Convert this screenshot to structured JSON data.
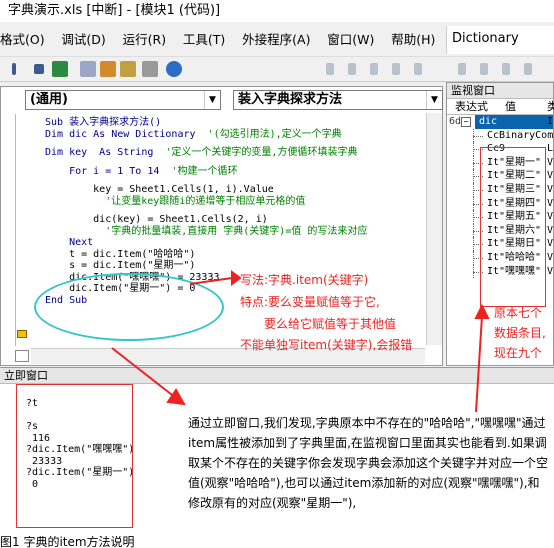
{
  "window": {
    "title": "字典演示.xls [中断] - [模块1 (代码)]"
  },
  "menu": {
    "items": [
      "格式(O)",
      "调试(D)",
      "运行(R)",
      "工具(T)",
      "外接程序(A)",
      "窗口(W)",
      "帮助(H)"
    ],
    "dictionary_box": "Dictionary"
  },
  "code_window": {
    "object_combo": "(通用)",
    "proc_combo": "装入字典探求方法",
    "lines": [
      {
        "code": "Sub 装入字典探求方法()",
        "comment": ""
      },
      {
        "code": "Dim dic As New Dictionary",
        "comment": "'(勾选引用法),定义一个字典"
      },
      {
        "code": "",
        "comment": ""
      },
      {
        "code": "Dim key  As String",
        "comment": "'定义一个关键字的变量,方便循环填装字典"
      },
      {
        "code": "",
        "comment": ""
      },
      {
        "code": "    For i = 1 To 14",
        "comment": "'构建一个循环"
      },
      {
        "code": "",
        "comment": ""
      },
      {
        "code": "        key = Sheet1.Cells(1, i).Value",
        "comment": ""
      },
      {
        "code": "        ",
        "comment": "'让变量key跟随i的递增等于相应单元格的值"
      },
      {
        "code": "",
        "comment": ""
      },
      {
        "code": "        dic(key) = Sheet1.Cells(2, i)",
        "comment": ""
      },
      {
        "code": "        ",
        "comment": "'字典的批量填装,直接用 字典(关键字)=值 的写法来对应"
      },
      {
        "code": "    Next",
        "comment": ""
      },
      {
        "code": "    t = dic.Item(\"哈哈哈\")",
        "comment": ""
      },
      {
        "code": "    s = dic.Item(\"星期一\")",
        "comment": ""
      },
      {
        "code": "    dic.Item(\"嘿嘿嘿\") = 23333",
        "comment": ""
      },
      {
        "code": "    dic.Item(\"星期一\") = 0",
        "comment": ""
      },
      {
        "code": "End Sub",
        "comment": ""
      }
    ]
  },
  "watch_window": {
    "title": "监视窗口",
    "col_expr": "表达式",
    "col_value": "值",
    "col_type": "类",
    "root": "dic",
    "items": [
      {
        "expr": "CcBinaryCompare",
        "value": ""
      },
      {
        "expr": "Cc9",
        "value": "L"
      },
      {
        "expr": "It\"星期一\"",
        "value": "V"
      },
      {
        "expr": "It\"星期二\"",
        "value": "V"
      },
      {
        "expr": "It\"星期三\"",
        "value": "V"
      },
      {
        "expr": "It\"星期四\"",
        "value": "V"
      },
      {
        "expr": "It\"星期五\"",
        "value": "V"
      },
      {
        "expr": "It\"星期六\"",
        "value": "V"
      },
      {
        "expr": "It\"星期日\"",
        "value": "V"
      },
      {
        "expr": "It\"哈哈哈\"",
        "value": "V"
      },
      {
        "expr": "It\"嘿嘿嘿\"",
        "value": "V"
      }
    ]
  },
  "immediate_window": {
    "title": "立即窗口",
    "lines": [
      "?t",
      "",
      "?s",
      " 116",
      "?dic.Item(\"嘿嘿嘿\")",
      " 23333",
      "?dic.Item(\"星期一\")",
      " 0"
    ]
  },
  "annotations": {
    "item_line1": "写法:字典.item(关键字)",
    "item_line2": "特点:要么变量赋值等于它,",
    "item_line3": "要么给它赋值等于其他值",
    "item_line4": "不能单独写item(关键字),会报错",
    "side": "原本七个数据条目,现在九个",
    "bottom_note": "通过立即窗口,我们发现,字典原本中不存在的\"哈哈哈\",\"嘿嘿嘿\"通过item属性被添加到了字典里面,在监视窗口里面其实也能看到.如果调取某个不存在的关键字你会发现字典会添加这个关键字并对应一个空值(观察\"哈哈哈\"),也可以通过item添加新的对应(观察\"嘿嘿嘿\"),和修改原有的对应(观察\"星期一\"),"
  },
  "footer_text": "图1  字典的item方法说明"
}
